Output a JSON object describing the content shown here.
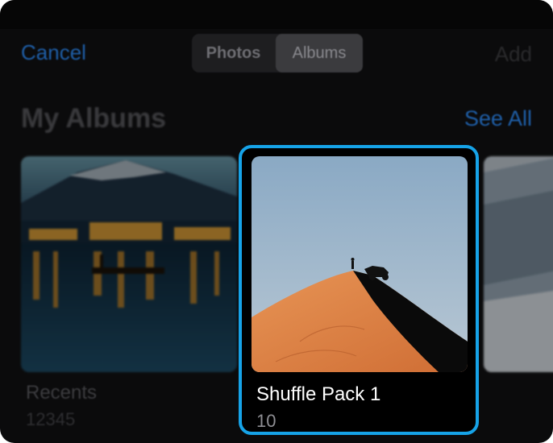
{
  "navbar": {
    "cancel_label": "Cancel",
    "segments": [
      {
        "label": "Photos",
        "selected": false
      },
      {
        "label": "Albums",
        "selected": true
      }
    ],
    "add_label": "Add"
  },
  "section": {
    "title": "My Albums",
    "see_all_label": "See All"
  },
  "albums": [
    {
      "name": "Recents",
      "count": "12345",
      "focused": false
    },
    {
      "name": "Shuffle Pack 1",
      "count": "10",
      "focused": true
    },
    {
      "name": "",
      "count": "",
      "focused": false
    }
  ],
  "colors": {
    "accent_blue": "#1f5fa8",
    "focus_ring": "#16a3e8",
    "background": "#0b0b0c"
  }
}
